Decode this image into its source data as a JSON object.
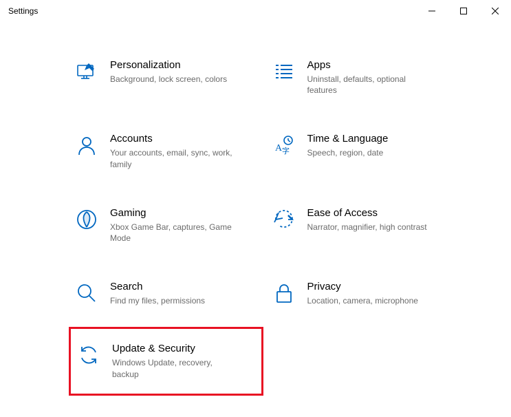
{
  "window": {
    "title": "Settings"
  },
  "colors": {
    "accent": "#0067c0",
    "text": "#000000",
    "muted": "#6b6b6b",
    "highlight": "#e81123"
  },
  "categories": [
    {
      "id": "personalization",
      "title": "Personalization",
      "desc": "Background, lock screen, colors",
      "icon": "personalization-icon"
    },
    {
      "id": "apps",
      "title": "Apps",
      "desc": "Uninstall, defaults, optional features",
      "icon": "apps-icon"
    },
    {
      "id": "accounts",
      "title": "Accounts",
      "desc": "Your accounts, email, sync, work, family",
      "icon": "accounts-icon"
    },
    {
      "id": "time-language",
      "title": "Time & Language",
      "desc": "Speech, region, date",
      "icon": "time-language-icon"
    },
    {
      "id": "gaming",
      "title": "Gaming",
      "desc": "Xbox Game Bar, captures, Game Mode",
      "icon": "gaming-icon"
    },
    {
      "id": "ease-of-access",
      "title": "Ease of Access",
      "desc": "Narrator, magnifier, high contrast",
      "icon": "ease-of-access-icon"
    },
    {
      "id": "search",
      "title": "Search",
      "desc": "Find my files, permissions",
      "icon": "search-icon"
    },
    {
      "id": "privacy",
      "title": "Privacy",
      "desc": "Location, camera, microphone",
      "icon": "privacy-icon"
    },
    {
      "id": "update-security",
      "title": "Update & Security",
      "desc": "Windows Update, recovery, backup",
      "icon": "update-security-icon",
      "highlighted": true
    }
  ]
}
